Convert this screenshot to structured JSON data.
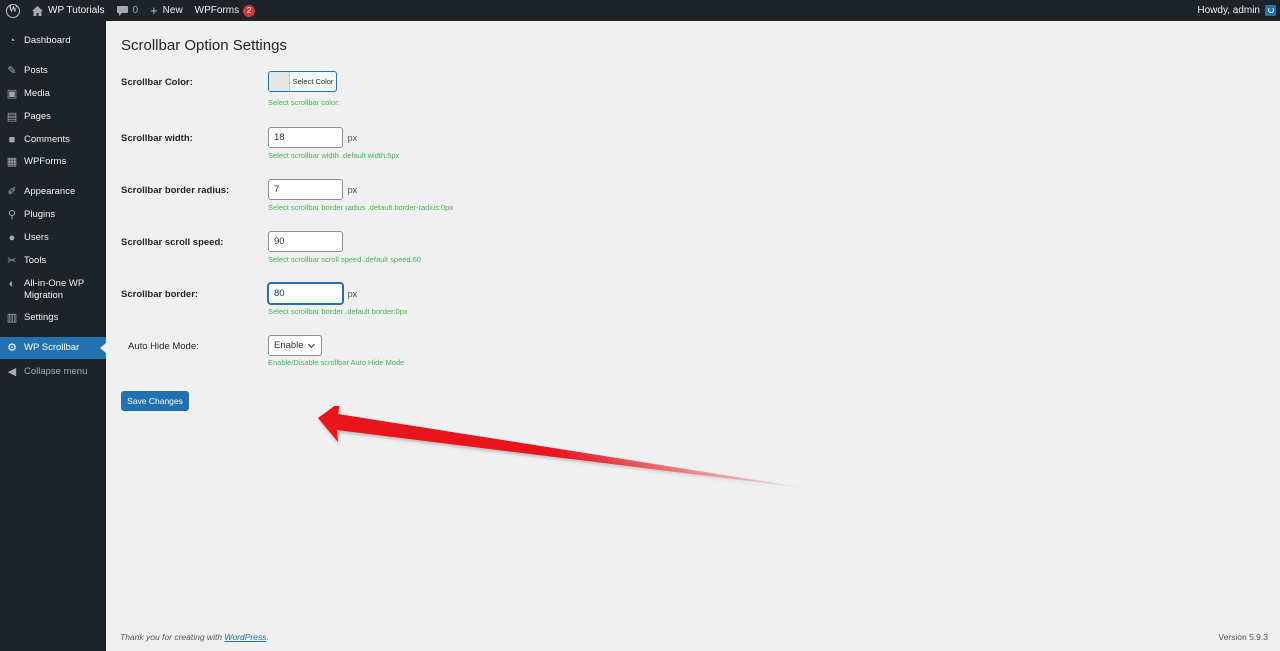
{
  "adminbar": {
    "site_name": "WP Tutorials",
    "comments_count": "0",
    "new_label": "New",
    "wpforms_label": "WPForms",
    "wpforms_badge": "2",
    "howdy": "Howdy, admin"
  },
  "sidebar": {
    "items": [
      {
        "label": "Dashboard",
        "icon": "dashboard-icon"
      },
      {
        "label": "Posts",
        "icon": "pin-icon"
      },
      {
        "label": "Media",
        "icon": "media-icon"
      },
      {
        "label": "Pages",
        "icon": "pages-icon"
      },
      {
        "label": "Comments",
        "icon": "comment-icon"
      },
      {
        "label": "WPForms",
        "icon": "forms-icon"
      },
      {
        "label": "Appearance",
        "icon": "brush-icon"
      },
      {
        "label": "Plugins",
        "icon": "plugin-icon"
      },
      {
        "label": "Users",
        "icon": "user-icon"
      },
      {
        "label": "Tools",
        "icon": "wrench-icon"
      },
      {
        "label": "All-in-One WP\nMigration",
        "icon": "migration-icon"
      },
      {
        "label": "Settings",
        "icon": "settings-icon"
      },
      {
        "label": "WP Scrollbar",
        "icon": "gear-icon"
      },
      {
        "label": "Collapse menu",
        "icon": "collapse-icon"
      }
    ]
  },
  "page": {
    "title": "Scrollbar Option Settings"
  },
  "settings": {
    "color": {
      "label": "Scrollbar Color:",
      "button": "Select Color",
      "hint": "Select scrollbar color:"
    },
    "width": {
      "label": "Scrollbar width:",
      "value": "18",
      "unit": "px",
      "hint": "Select scrollbar width .default width:5px"
    },
    "radius": {
      "label": "Scrollbar border radius:",
      "value": "7",
      "unit": "px",
      "hint": "Select scrollbar border radius .default border-radius:0px"
    },
    "speed": {
      "label": "Scrollbar scroll speed:",
      "value": "90",
      "hint": "Select scrollbar scroll speed .default speed:60"
    },
    "border": {
      "label": "Scrollbar border:",
      "value": "80",
      "unit": "px",
      "hint": "Select scrollbar border .default border:0px"
    },
    "autohide": {
      "label": "Auto Hide Mode:",
      "value": "Enable",
      "hint": "Enable/Disable scrollbar Auto Hide Mode"
    }
  },
  "save_label": "Save Changes",
  "footer": {
    "thanks_prefix": "Thank you for creating with ",
    "thanks_link": "WordPress",
    "thanks_suffix": ".",
    "version": "Version 5.9.3"
  },
  "colors": {
    "admin_dark": "#1d2327",
    "accent": "#2271b1",
    "hint_green": "#46b450",
    "badge_red": "#d63638",
    "annotation_arrow": "#e8121a"
  }
}
